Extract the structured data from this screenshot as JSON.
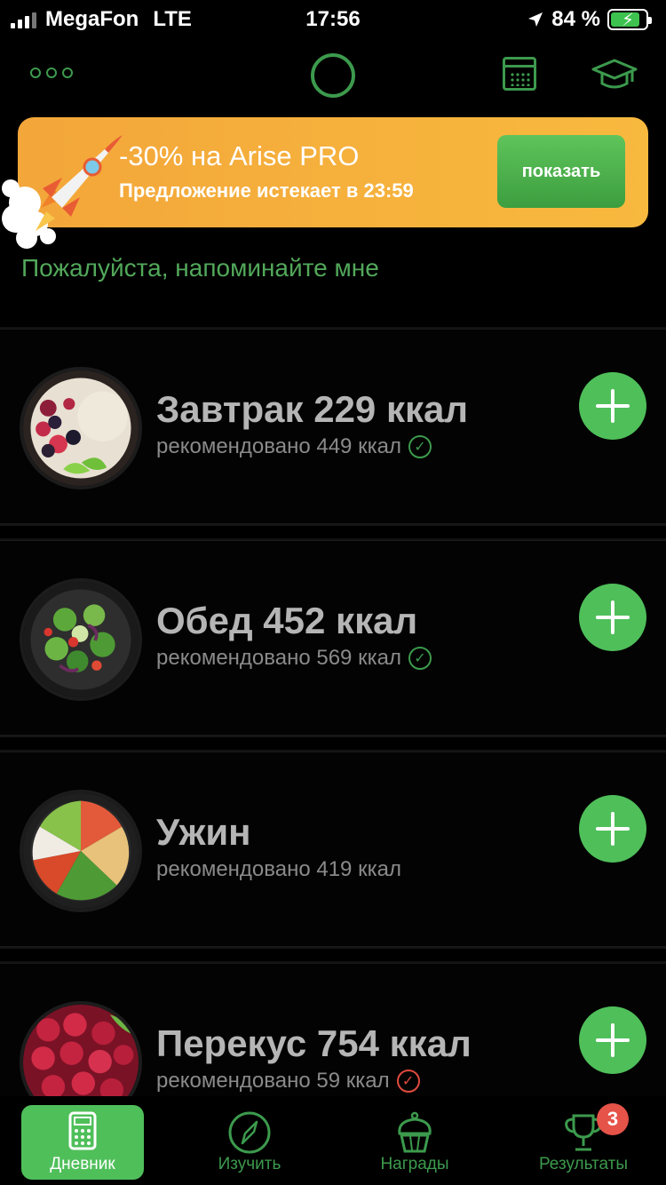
{
  "status_bar": {
    "carrier": "MegaFon",
    "network": "LTE",
    "time": "17:56",
    "battery": "84 %",
    "battery_level": 0.84
  },
  "promo": {
    "title": "-30% на Arise PRO",
    "subtitle": "Предложение истекает в 23:59",
    "button": "показать"
  },
  "reminder_text": "Пожалуйста, напоминайте мне",
  "meals": [
    {
      "name": "Завтрак 229 ккал",
      "recommended": "рекомендовано 449 ккал",
      "status": "ok"
    },
    {
      "name": "Обед 452 ккал",
      "recommended": "рекомендовано 569 ккал",
      "status": "ok"
    },
    {
      "name": "Ужин",
      "recommended": "рекомендовано 419 ккал",
      "status": "none"
    },
    {
      "name": "Перекус 754 ккал",
      "recommended": "рекомендовано 59 ккал",
      "status": "over"
    }
  ],
  "tabs": [
    {
      "label": "Дневник",
      "active": true
    },
    {
      "label": "Изучить",
      "active": false
    },
    {
      "label": "Награды",
      "active": false
    },
    {
      "label": "Результаты",
      "active": false
    }
  ],
  "results_badge": "3",
  "colors": {
    "accent": "#4fbf5a",
    "promo": "#f6b23c",
    "warning": "#e04a3e"
  }
}
